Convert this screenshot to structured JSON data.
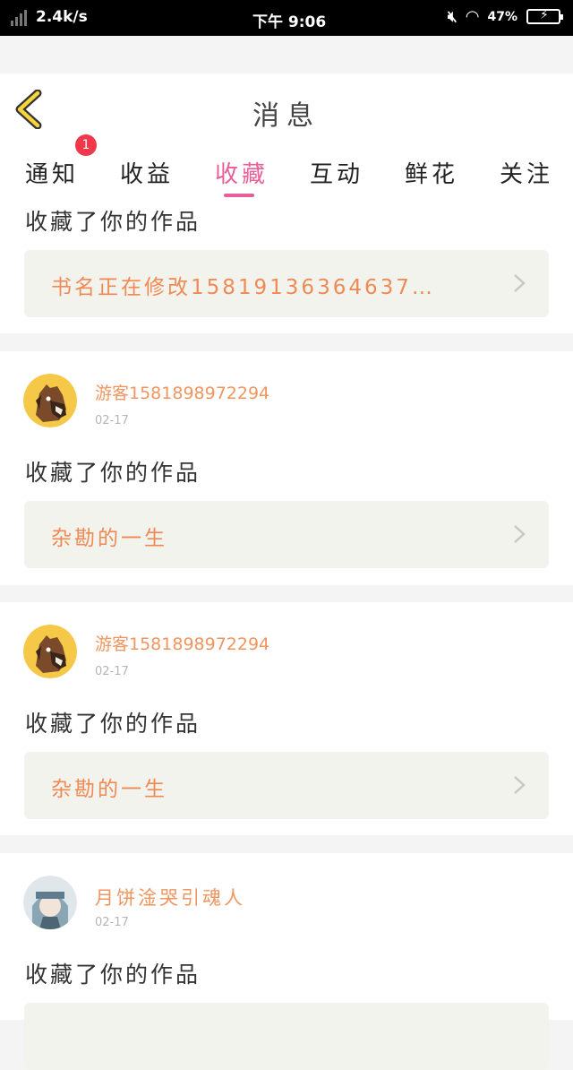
{
  "status_bar": {
    "network_speed": "2.4k/s",
    "time": "下午 9:06",
    "battery_percent": "47%"
  },
  "header": {
    "title": "消息"
  },
  "tabs": {
    "items": [
      {
        "label": "通知"
      },
      {
        "label": "收益"
      },
      {
        "label": "收藏"
      },
      {
        "label": "互动"
      },
      {
        "label": "鲜花"
      },
      {
        "label": "关注"
      }
    ],
    "active_index": 2,
    "notification_badge": "1"
  },
  "entries": [
    {
      "message": "收藏了你的作品",
      "work_title": "书名正在修改15819136364637…"
    },
    {
      "username": "游客15818989722​94",
      "date": "02-17",
      "message": "收藏了你的作品",
      "work_title": "杂勘的一生"
    },
    {
      "username": "游客1581898972294",
      "date": "02-17",
      "message": "收藏了你的作品",
      "work_title": "杂勘的一生"
    },
    {
      "username": "月饼淦哭引魂人",
      "date": "02-17",
      "message": "收藏了你的作品"
    }
  ],
  "colors": {
    "accent_pink": "#e85e98",
    "username_orange": "#f0955f",
    "work_title_orange": "#f08a55",
    "badge_red": "#f0384a",
    "back_arrow_yellow": "#f6d43a"
  }
}
